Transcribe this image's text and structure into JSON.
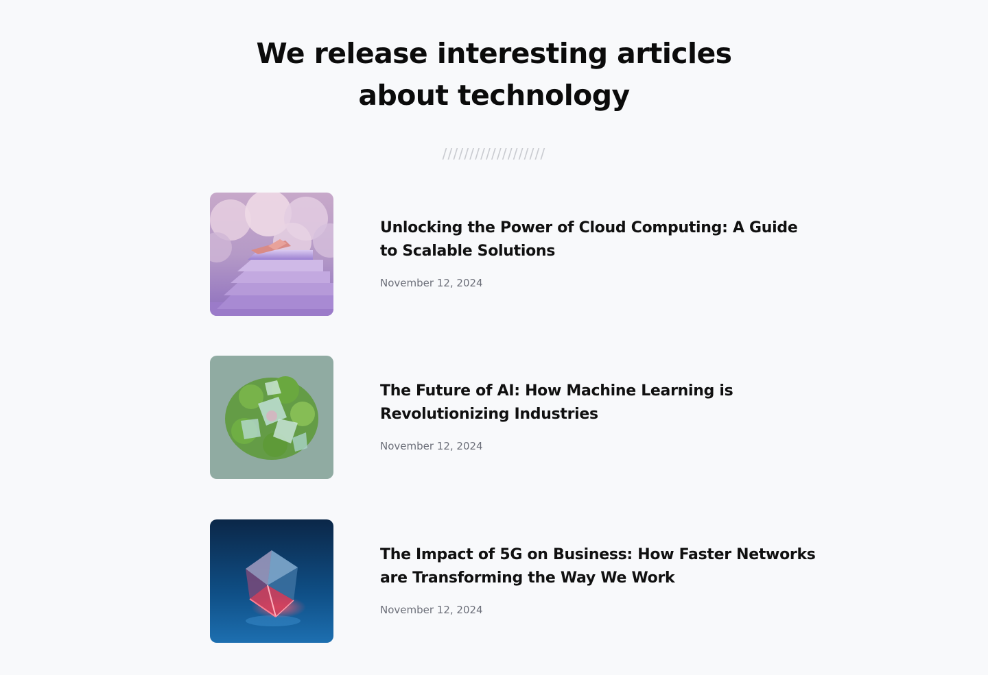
{
  "section": {
    "title_line1": "We release interesting articles",
    "title_line2": "about technology",
    "divider": "///////////////////"
  },
  "articles": [
    {
      "title_line1": "Unlocking the Power of Cloud Computing: A Guide",
      "title_line2": "to Scalable Solutions",
      "date": "November 12, 2024",
      "image": "clouds-stairs-image"
    },
    {
      "title_line1": "The Future of AI: How Machine Learning is",
      "title_line2": "Revolutionizing Industries",
      "date": "November 12, 2024",
      "image": "green-crystal-plant-image"
    },
    {
      "title_line1": "The Impact of 5G on Business: How Faster Networks",
      "title_line2": "are Transforming the Way We Work",
      "date": "November 12, 2024",
      "image": "glass-cube-image"
    }
  ],
  "colors": {
    "background": "#f8f9fb",
    "title": "#0b0b0b",
    "date": "#6b6e78",
    "divider": "#c9cbd0"
  }
}
